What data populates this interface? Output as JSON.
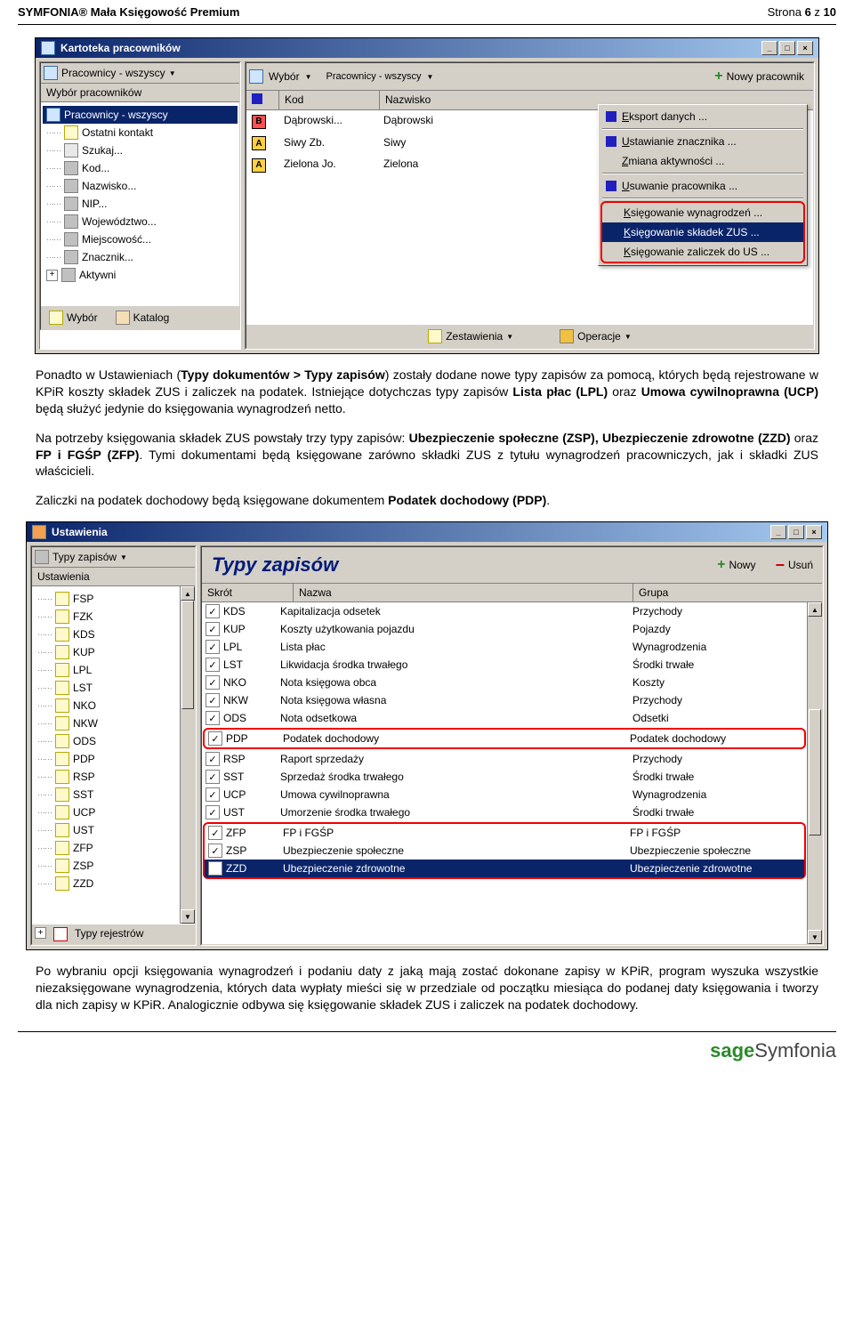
{
  "header": {
    "left": "SYMFONIA® Mała Księgowość Premium",
    "right_prefix": "Strona ",
    "page": "6",
    "of_prefix": " z ",
    "of": "10"
  },
  "win1": {
    "title": "Kartoteka pracowników",
    "left_toolbar": "Pracownicy - wszyscy",
    "left_section": "Wybór pracowników",
    "tree": [
      {
        "label": "Pracownicy - wszyscy",
        "sel": true,
        "icon": "people"
      },
      {
        "label": "Ostatni kontakt",
        "dots": true,
        "icon": "doc"
      },
      {
        "label": "Szukaj...",
        "dots": true,
        "icon": "search"
      },
      {
        "label": "Kod...",
        "dots": true,
        "icon": "ic"
      },
      {
        "label": "Nazwisko...",
        "dots": true,
        "icon": "ic"
      },
      {
        "label": "NIP...",
        "dots": true,
        "icon": "ic"
      },
      {
        "label": "Województwo...",
        "dots": true,
        "icon": "ic"
      },
      {
        "label": "Miejscowość...",
        "dots": true,
        "icon": "ic"
      },
      {
        "label": "Znacznik...",
        "dots": true,
        "icon": "ic"
      },
      {
        "label": "Aktywni",
        "dots": true,
        "icon": "ic",
        "expand": "+"
      }
    ],
    "left_tabs": {
      "wybor": "Wybór",
      "katalog": "Katalog"
    },
    "right_toolbar": {
      "wybor": "Wybór",
      "drop": "Pracownicy - wszyscy",
      "nowy": "Nowy pracownik"
    },
    "cols": {
      "marker": "",
      "kod": "Kod",
      "nazwisko": "Nazwisko"
    },
    "rows": [
      {
        "badge": "B",
        "badgeClass": "badge-b",
        "kod": "Dąbrowski...",
        "nazwisko": "Dąbrowski"
      },
      {
        "badge": "A",
        "badgeClass": "badge-a",
        "kod": "Siwy Zb.",
        "nazwisko": "Siwy"
      },
      {
        "badge": "A",
        "badgeClass": "badge-a",
        "kod": "Zielona Jo.",
        "nazwisko": "Zielona"
      }
    ],
    "bottom": {
      "zest": "Zestawienia",
      "oper": "Operacje"
    },
    "ctx": [
      {
        "type": "item",
        "label": "Eksport danych ...",
        "marker": true
      },
      {
        "type": "sep"
      },
      {
        "type": "item",
        "label": "Ustawianie znacznika ...",
        "marker": true
      },
      {
        "type": "item",
        "label": "Zmiana aktywności ..."
      },
      {
        "type": "sep"
      },
      {
        "type": "item",
        "label": "Usuwanie pracownika ...",
        "marker": true
      },
      {
        "type": "sep"
      },
      {
        "type": "boxstart"
      },
      {
        "type": "item",
        "label": "Księgowanie wynagrodzeń ..."
      },
      {
        "type": "item",
        "label": "Księgowanie składek ZUS ...",
        "sel": true
      },
      {
        "type": "item",
        "label": "Księgowanie zaliczek do US ..."
      },
      {
        "type": "boxend"
      }
    ]
  },
  "para1": {
    "t1": "Ponadto w Ustawieniach (",
    "b1": "Typy dokumentów > Typy zapisów",
    "t2": ") zostały dodane nowe typy zapisów za pomocą, których będą rejestrowane w KPiR koszty składek ZUS i zaliczek na podatek. Istniejące dotychczas typy zapisów ",
    "b2": "Lista płac (LPL)",
    "t3": " oraz ",
    "b3": "Umowa cywilnoprawna (UCP)",
    "t4": " będą służyć jedynie do księgowania wynagrodzeń netto."
  },
  "para2": {
    "t1": "Na potrzeby księgowania składek ZUS powstały trzy typy zapisów: ",
    "b1": "Ubezpieczenie społeczne (ZSP), Ubezpieczenie zdrowotne (ZZD)",
    "t2": " oraz ",
    "b2": "FP i FGŚP (ZFP)",
    "t3": ". Tymi dokumentami będą księgowane zarówno składki ZUS z tytułu wynagrodzeń pracowniczych, jak i składki ZUS właścicieli."
  },
  "para3": {
    "t1": "Zaliczki na podatek dochodowy będą księgowane dokumentem ",
    "b1": "Podatek dochodowy (PDP)",
    "t2": "."
  },
  "win2": {
    "title": "Ustawienia",
    "left_toolbar": "Typy zapisów",
    "left_section": "Ustawienia",
    "tree": [
      "FSP",
      "FZK",
      "KDS",
      "KUP",
      "LPL",
      "LST",
      "NKO",
      "NKW",
      "ODS",
      "PDP",
      "RSP",
      "SST",
      "UCP",
      "UST",
      "ZFP",
      "ZSP",
      "ZZD"
    ],
    "left_bottom": "Typy rejestrów",
    "big_title": "Typy zapisów",
    "nowy": "Nowy",
    "usun": "Usuń",
    "cols": {
      "skrot": "Skrót",
      "nazwa": "Nazwa",
      "grupa": "Grupa"
    },
    "rows": [
      {
        "skrot": "KDS",
        "nazwa": "Kapitalizacja odsetek",
        "grupa": "Przychody"
      },
      {
        "skrot": "KUP",
        "nazwa": "Koszty użytkowania pojazdu",
        "grupa": "Pojazdy"
      },
      {
        "skrot": "LPL",
        "nazwa": "Lista płac",
        "grupa": "Wynagrodzenia"
      },
      {
        "skrot": "LST",
        "nazwa": "Likwidacja środka trwałego",
        "grupa": "Środki trwałe"
      },
      {
        "skrot": "NKO",
        "nazwa": "Nota księgowa obca",
        "grupa": "Koszty"
      },
      {
        "skrot": "NKW",
        "nazwa": "Nota księgowa własna",
        "grupa": "Przychody"
      },
      {
        "skrot": "ODS",
        "nazwa": "Nota odsetkowa",
        "grupa": "Odsetki"
      }
    ],
    "hl1": {
      "skrot": "PDP",
      "nazwa": "Podatek dochodowy",
      "grupa": "Podatek dochodowy"
    },
    "rows2": [
      {
        "skrot": "RSP",
        "nazwa": "Raport sprzedaży",
        "grupa": "Przychody"
      },
      {
        "skrot": "SST",
        "nazwa": "Sprzedaż środka trwałego",
        "grupa": "Środki trwałe"
      },
      {
        "skrot": "UCP",
        "nazwa": "Umowa cywilnoprawna",
        "grupa": "Wynagrodzenia"
      },
      {
        "skrot": "UST",
        "nazwa": "Umorzenie środka trwałego",
        "grupa": "Środki trwałe"
      }
    ],
    "hl2": [
      {
        "skrot": "ZFP",
        "nazwa": "FP i FGŚP",
        "grupa": "FP i FGŚP"
      },
      {
        "skrot": "ZSP",
        "nazwa": "Ubezpieczenie społeczne",
        "grupa": "Ubezpieczenie społeczne"
      },
      {
        "skrot": "ZZD",
        "nazwa": "Ubezpieczenie zdrowotne",
        "grupa": "Ubezpieczenie zdrowotne",
        "sel": true
      }
    ]
  },
  "para4": {
    "t1": "Po wybraniu opcji księgowania wynagrodzeń i podaniu daty z jaką mają zostać dokonane zapisy w KPiR, program wyszuka wszystkie niezaksięgowane wynagrodzenia, których data wypłaty mieści się w przedziale od początku miesiąca do podanej daty księgowania i tworzy dla nich zapisy w KPiR. Analogicznie odbywa się księgowanie składek ZUS i zaliczek na podatek dochodowy."
  },
  "footer": {
    "sage": "sage",
    "sym": "Symfonia"
  }
}
